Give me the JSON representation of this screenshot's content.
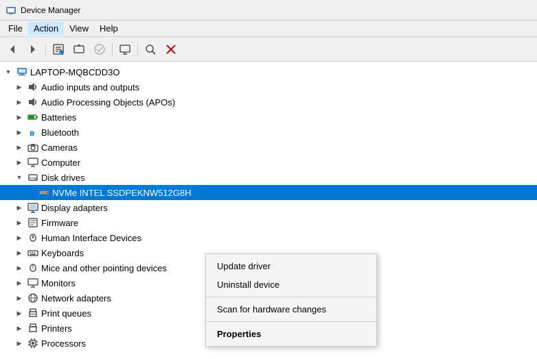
{
  "titleBar": {
    "title": "Device Manager",
    "icon": "🖥"
  },
  "menuBar": {
    "items": [
      {
        "label": "File",
        "id": "file"
      },
      {
        "label": "Action",
        "id": "action"
      },
      {
        "label": "View",
        "id": "view"
      },
      {
        "label": "Help",
        "id": "help"
      }
    ]
  },
  "toolbar": {
    "buttons": [
      {
        "id": "back",
        "icon": "◀",
        "disabled": false
      },
      {
        "id": "forward",
        "icon": "▶",
        "disabled": false
      },
      {
        "id": "props",
        "icon": "📋",
        "disabled": false
      },
      {
        "id": "update",
        "icon": "🔄",
        "disabled": false
      },
      {
        "id": "enable",
        "icon": "✔",
        "disabled": false
      },
      {
        "id": "monitor",
        "icon": "🖥",
        "disabled": false
      },
      {
        "id": "scan",
        "icon": "🔍",
        "disabled": false
      },
      {
        "id": "delete",
        "icon": "✖",
        "disabled": false,
        "color": "red"
      }
    ]
  },
  "tree": {
    "root": {
      "label": "LAPTOP-MQBCDD3O",
      "expanded": true,
      "children": [
        {
          "label": "Audio inputs and outputs",
          "icon": "🔊",
          "indent": 2,
          "expandable": true
        },
        {
          "label": "Audio Processing Objects (APOs)",
          "icon": "🔊",
          "indent": 2,
          "expandable": true
        },
        {
          "label": "Batteries",
          "icon": "🔋",
          "indent": 2,
          "expandable": true
        },
        {
          "label": "Bluetooth",
          "icon": "🔵",
          "indent": 2,
          "expandable": true
        },
        {
          "label": "Cameras",
          "icon": "📷",
          "indent": 2,
          "expandable": true
        },
        {
          "label": "Computer",
          "icon": "🖥",
          "indent": 2,
          "expandable": true
        },
        {
          "label": "Disk drives",
          "icon": "💾",
          "indent": 2,
          "expandable": true,
          "expanded": true,
          "children": [
            {
              "label": "NVMe INTEL SSDPEKNW512G8H",
              "icon": "💾",
              "indent": 4,
              "selected": true
            }
          ]
        },
        {
          "label": "Display adapters",
          "icon": "🖥",
          "indent": 2,
          "expandable": true
        },
        {
          "label": "Firmware",
          "icon": "📄",
          "indent": 2,
          "expandable": true
        },
        {
          "label": "Human Interface Devices",
          "icon": "🖱",
          "indent": 2,
          "expandable": true
        },
        {
          "label": "Keyboards",
          "icon": "⌨",
          "indent": 2,
          "expandable": true
        },
        {
          "label": "Mice and other pointing devices",
          "icon": "🖱",
          "indent": 2,
          "expandable": true
        },
        {
          "label": "Monitors",
          "icon": "🖥",
          "indent": 2,
          "expandable": true
        },
        {
          "label": "Network adapters",
          "icon": "🌐",
          "indent": 2,
          "expandable": true
        },
        {
          "label": "Print queues",
          "icon": "🖨",
          "indent": 2,
          "expandable": true
        },
        {
          "label": "Printers",
          "icon": "🖨",
          "indent": 2,
          "expandable": true
        },
        {
          "label": "Processors",
          "icon": "⚙",
          "indent": 2,
          "expandable": true
        }
      ]
    }
  },
  "contextMenu": {
    "visible": true,
    "items": [
      {
        "label": "Update driver",
        "bold": false,
        "id": "update-driver"
      },
      {
        "label": "Uninstall device",
        "bold": false,
        "id": "uninstall-device"
      },
      {
        "separator": true
      },
      {
        "label": "Scan for hardware changes",
        "bold": false,
        "id": "scan-changes"
      },
      {
        "separator": true
      },
      {
        "label": "Properties",
        "bold": true,
        "id": "properties"
      }
    ]
  }
}
